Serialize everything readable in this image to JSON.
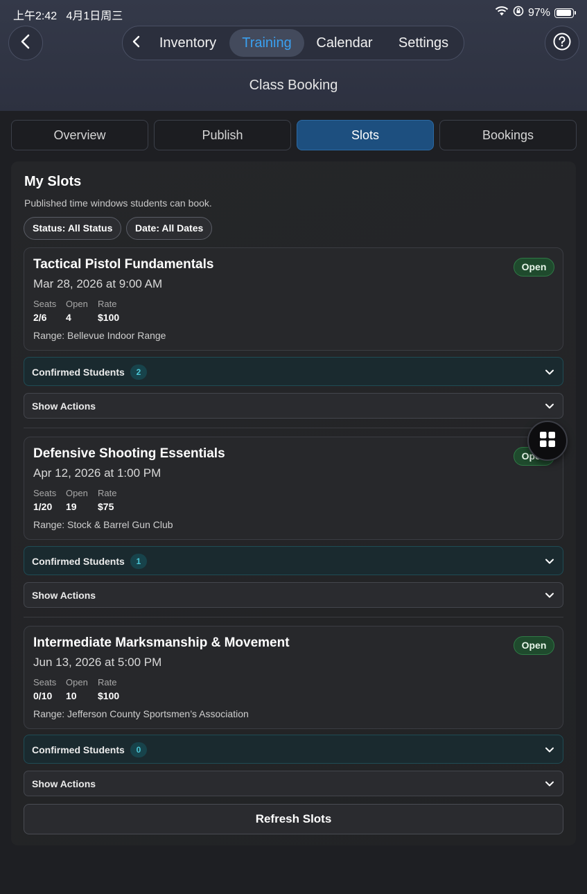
{
  "status_bar": {
    "time": "上午2:42",
    "date": "4月1日周三",
    "battery": "97%"
  },
  "nav": {
    "tabs": [
      {
        "label": "Inventory",
        "active": false
      },
      {
        "label": "Training",
        "active": true
      },
      {
        "label": "Calendar",
        "active": false
      },
      {
        "label": "Settings",
        "active": false
      }
    ],
    "page_title": "Class Booking"
  },
  "segments": [
    {
      "label": "Overview",
      "active": false
    },
    {
      "label": "Publish",
      "active": false
    },
    {
      "label": "Slots",
      "active": true
    },
    {
      "label": "Bookings",
      "active": false
    }
  ],
  "slots_panel": {
    "title": "My Slots",
    "subtitle": "Published time windows students can book.",
    "filters": {
      "status": "Status: All Status",
      "date": "Date: All Dates"
    },
    "labels": {
      "seats": "Seats",
      "open": "Open",
      "rate": "Rate",
      "confirmed_students": "Confirmed Students",
      "show_actions": "Show Actions"
    },
    "slots": [
      {
        "title": "Tactical Pistol Fundamentals",
        "datetime": "Mar 28, 2026 at 9:00 AM",
        "status": "Open",
        "seats": "2/6",
        "open": "4",
        "rate": "$100",
        "range": "Range: Bellevue Indoor Range",
        "confirmed_count": "2"
      },
      {
        "title": "Defensive Shooting Essentials",
        "datetime": "Apr 12, 2026 at 1:00 PM",
        "status": "Open",
        "seats": "1/20",
        "open": "19",
        "rate": "$75",
        "range": "Range: Stock & Barrel Gun Club",
        "confirmed_count": "1"
      },
      {
        "title": "Intermediate Marksmanship & Movement",
        "datetime": "Jun 13, 2026 at 5:00 PM",
        "status": "Open",
        "seats": "0/10",
        "open": "10",
        "rate": "$100",
        "range": "Range: Jefferson County Sportsmen’s Association",
        "confirmed_count": "0"
      }
    ],
    "refresh_label": "Refresh Slots"
  },
  "icons": {
    "back": "chevron-left-icon",
    "help": "question-circle-icon",
    "fab": "grid-icon",
    "expand": "chevron-down-icon"
  },
  "colors": {
    "accent_blue": "#3aa0f0",
    "active_segment": "#1d4f7f",
    "open_badge": "#1f4a2d",
    "count_badge_text": "#4cc7d6"
  }
}
